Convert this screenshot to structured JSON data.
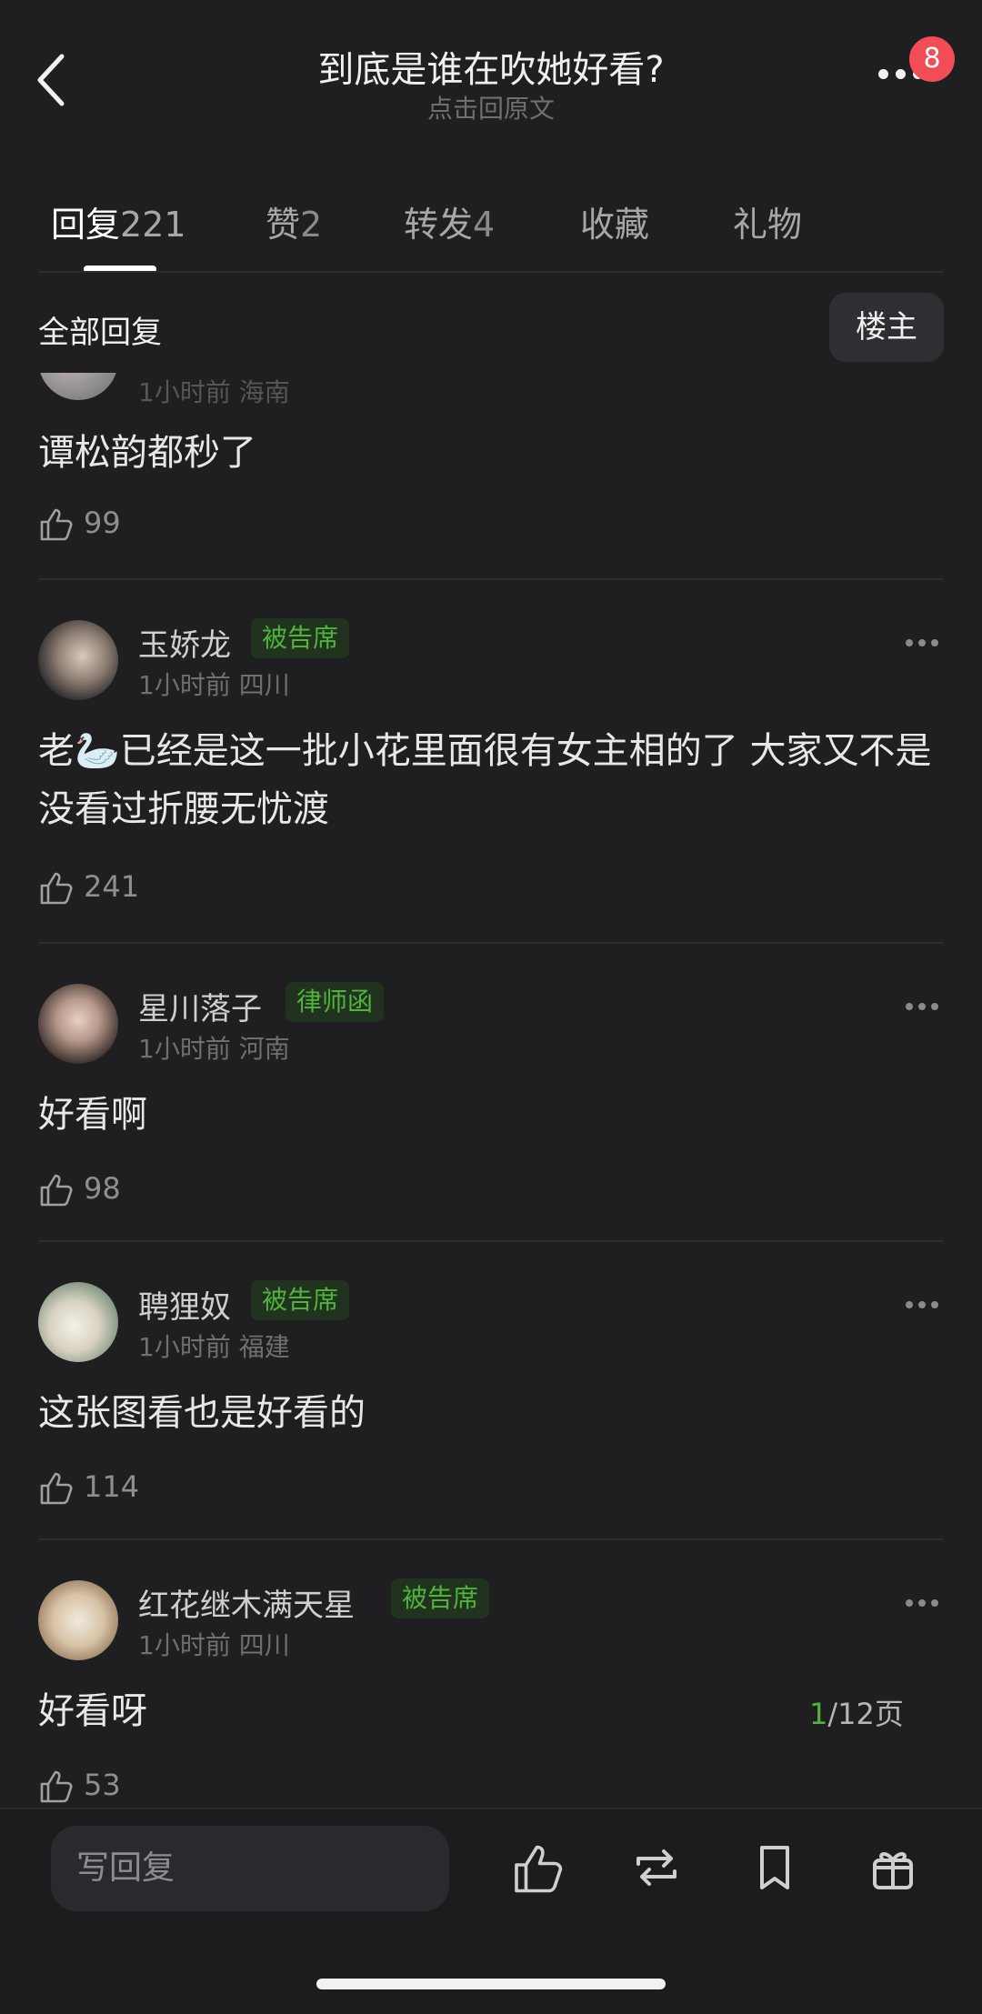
{
  "header": {
    "title": "到底是谁在吹她好看?",
    "subtitle": "点击回原文",
    "badge_count": "8"
  },
  "tabs": [
    {
      "label": "回复",
      "count": "221"
    },
    {
      "label": "赞",
      "count": "2"
    },
    {
      "label": "转发",
      "count": "4"
    },
    {
      "label": "收藏",
      "count": ""
    },
    {
      "label": "礼物",
      "count": ""
    }
  ],
  "filter": {
    "label": "全部回复",
    "owner_button": "楼主"
  },
  "partial_comment": {
    "meta": "1小时前  海南",
    "text": "谭松韵都秒了",
    "likes": "99"
  },
  "comments": [
    {
      "name": "玉娇龙",
      "tag": "被告席",
      "time": "1小时前",
      "location": "四川",
      "text": "老🦢已经是这一批小花里面很有女主相的了 大家又不是没看过折腰无忧渡",
      "likes": "241"
    },
    {
      "name": "星川落子",
      "tag": "律师函",
      "time": "1小时前",
      "location": "河南",
      "text": "好看啊",
      "likes": "98"
    },
    {
      "name": "聘狸奴",
      "tag": "被告席",
      "time": "1小时前",
      "location": "福建",
      "text": "这张图看也是好看的",
      "likes": "114"
    },
    {
      "name": "红花继木满天星",
      "tag": "被告席",
      "time": "1小时前",
      "location": "四川",
      "text": "好看呀",
      "likes": "53"
    }
  ],
  "pager": {
    "current": "1",
    "total_text": "/12页"
  },
  "bottom_bar": {
    "reply_placeholder": "写回复"
  },
  "colors": {
    "background": "#1f1f21",
    "tag_green": "#4fb33c",
    "badge_red": "#f24d57"
  },
  "icons": [
    "back-arrow-icon",
    "more-icon",
    "thumbs-up-icon",
    "repost-icon",
    "bookmark-icon",
    "gift-icon"
  ]
}
